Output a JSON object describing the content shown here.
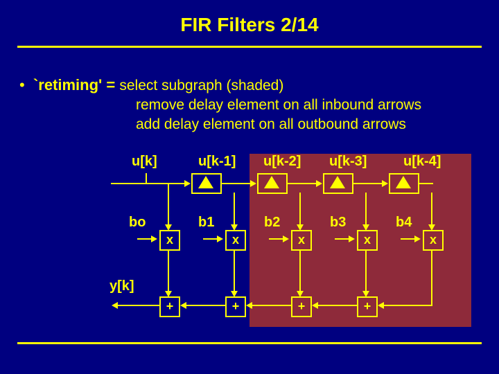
{
  "slide": {
    "title": "FIR Filters  2/14",
    "bullet_term": "`retiming' =",
    "bullet_desc": "select subgraph (shaded)",
    "line2": "remove delay element on all inbound arrows",
    "line3": "add delay element on all outbound arrows"
  },
  "diagram": {
    "inputs": [
      "u[k]",
      "u[k-1]",
      "u[k-2]",
      "u[k-3]",
      "u[k-4]"
    ],
    "coeffs": [
      "bo",
      "b1",
      "b2",
      "b3",
      "b4"
    ],
    "mult_symbol": "x",
    "add_symbol": "+",
    "output": "y[k]"
  }
}
